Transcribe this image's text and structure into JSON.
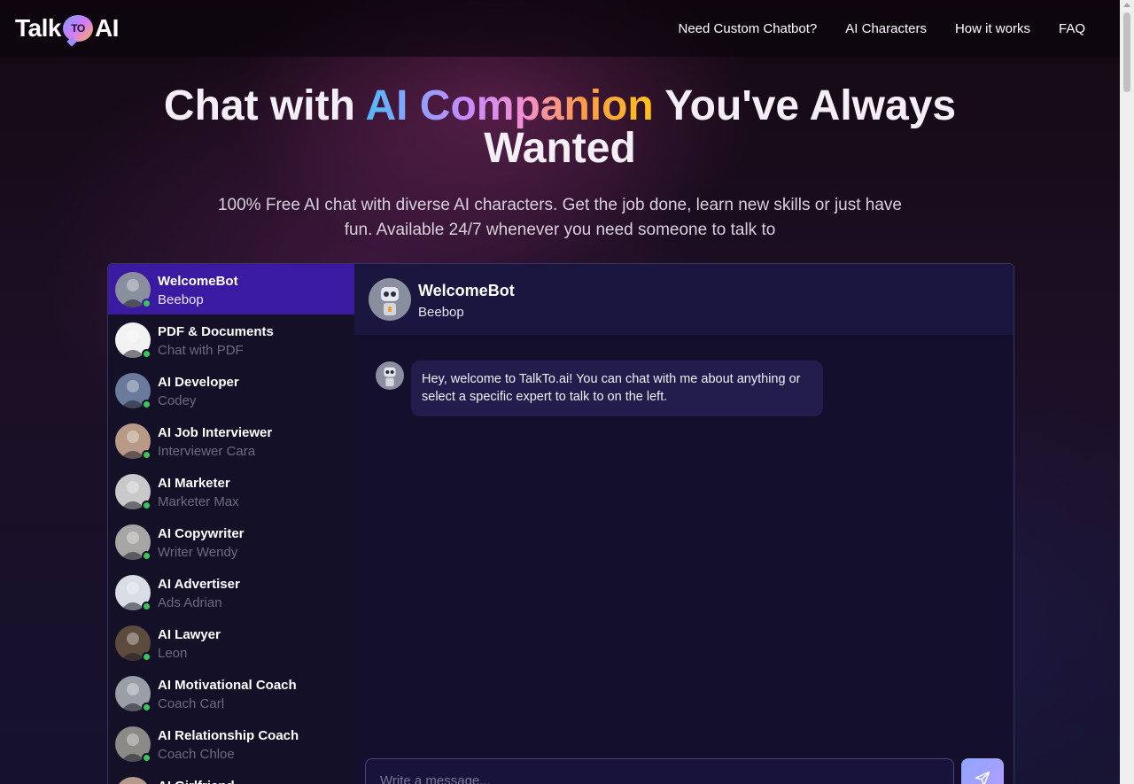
{
  "header": {
    "logo_left": "Talk",
    "logo_bubble": "TO",
    "logo_right": "AI",
    "nav": [
      "Need Custom Chatbot?",
      "AI Characters",
      "How it works",
      "FAQ"
    ]
  },
  "hero": {
    "title_part1": "Chat with ",
    "title_gradient": "AI Companion",
    "title_part2": " You've Always Wanted",
    "subtitle": "100% Free AI chat with diverse AI characters. Get the job done, learn new skills or just have fun. Available 24/7 whenever you need someone to talk to"
  },
  "contacts": [
    {
      "name": "WelcomeBot",
      "sub": "Beebop",
      "active": true,
      "color": "#8a8fa0"
    },
    {
      "name": "PDF & Documents",
      "sub": "Chat with PDF",
      "color": "#f2f2f2"
    },
    {
      "name": "AI Developer",
      "sub": "Codey",
      "color": "#6a7a9a"
    },
    {
      "name": "AI Job Interviewer",
      "sub": "Interviewer Cara",
      "color": "#b89a86"
    },
    {
      "name": "AI Marketer",
      "sub": "Marketer Max",
      "color": "#c9c9cc"
    },
    {
      "name": "AI Copywriter",
      "sub": "Writer Wendy",
      "color": "#a8a6a4"
    },
    {
      "name": "AI Advertiser",
      "sub": "Ads Adrian",
      "color": "#d8dde6"
    },
    {
      "name": "AI Lawyer",
      "sub": "Leon",
      "color": "#5c4a3c"
    },
    {
      "name": "AI Motivational Coach",
      "sub": "Coach Carl",
      "color": "#9a9ea6"
    },
    {
      "name": "AI Relationship Coach",
      "sub": "Coach Chloe",
      "color": "#8c8a86"
    },
    {
      "name": "AI Girlfriend",
      "sub": "",
      "color": "#b49a8a"
    }
  ],
  "chat": {
    "name": "WelcomeBot",
    "sub": "Beebop",
    "message": "Hey, welcome to TalkTo.ai! You can chat with me about anything or select a specific expert to talk to on the left.",
    "input_placeholder": "Write a message..."
  }
}
